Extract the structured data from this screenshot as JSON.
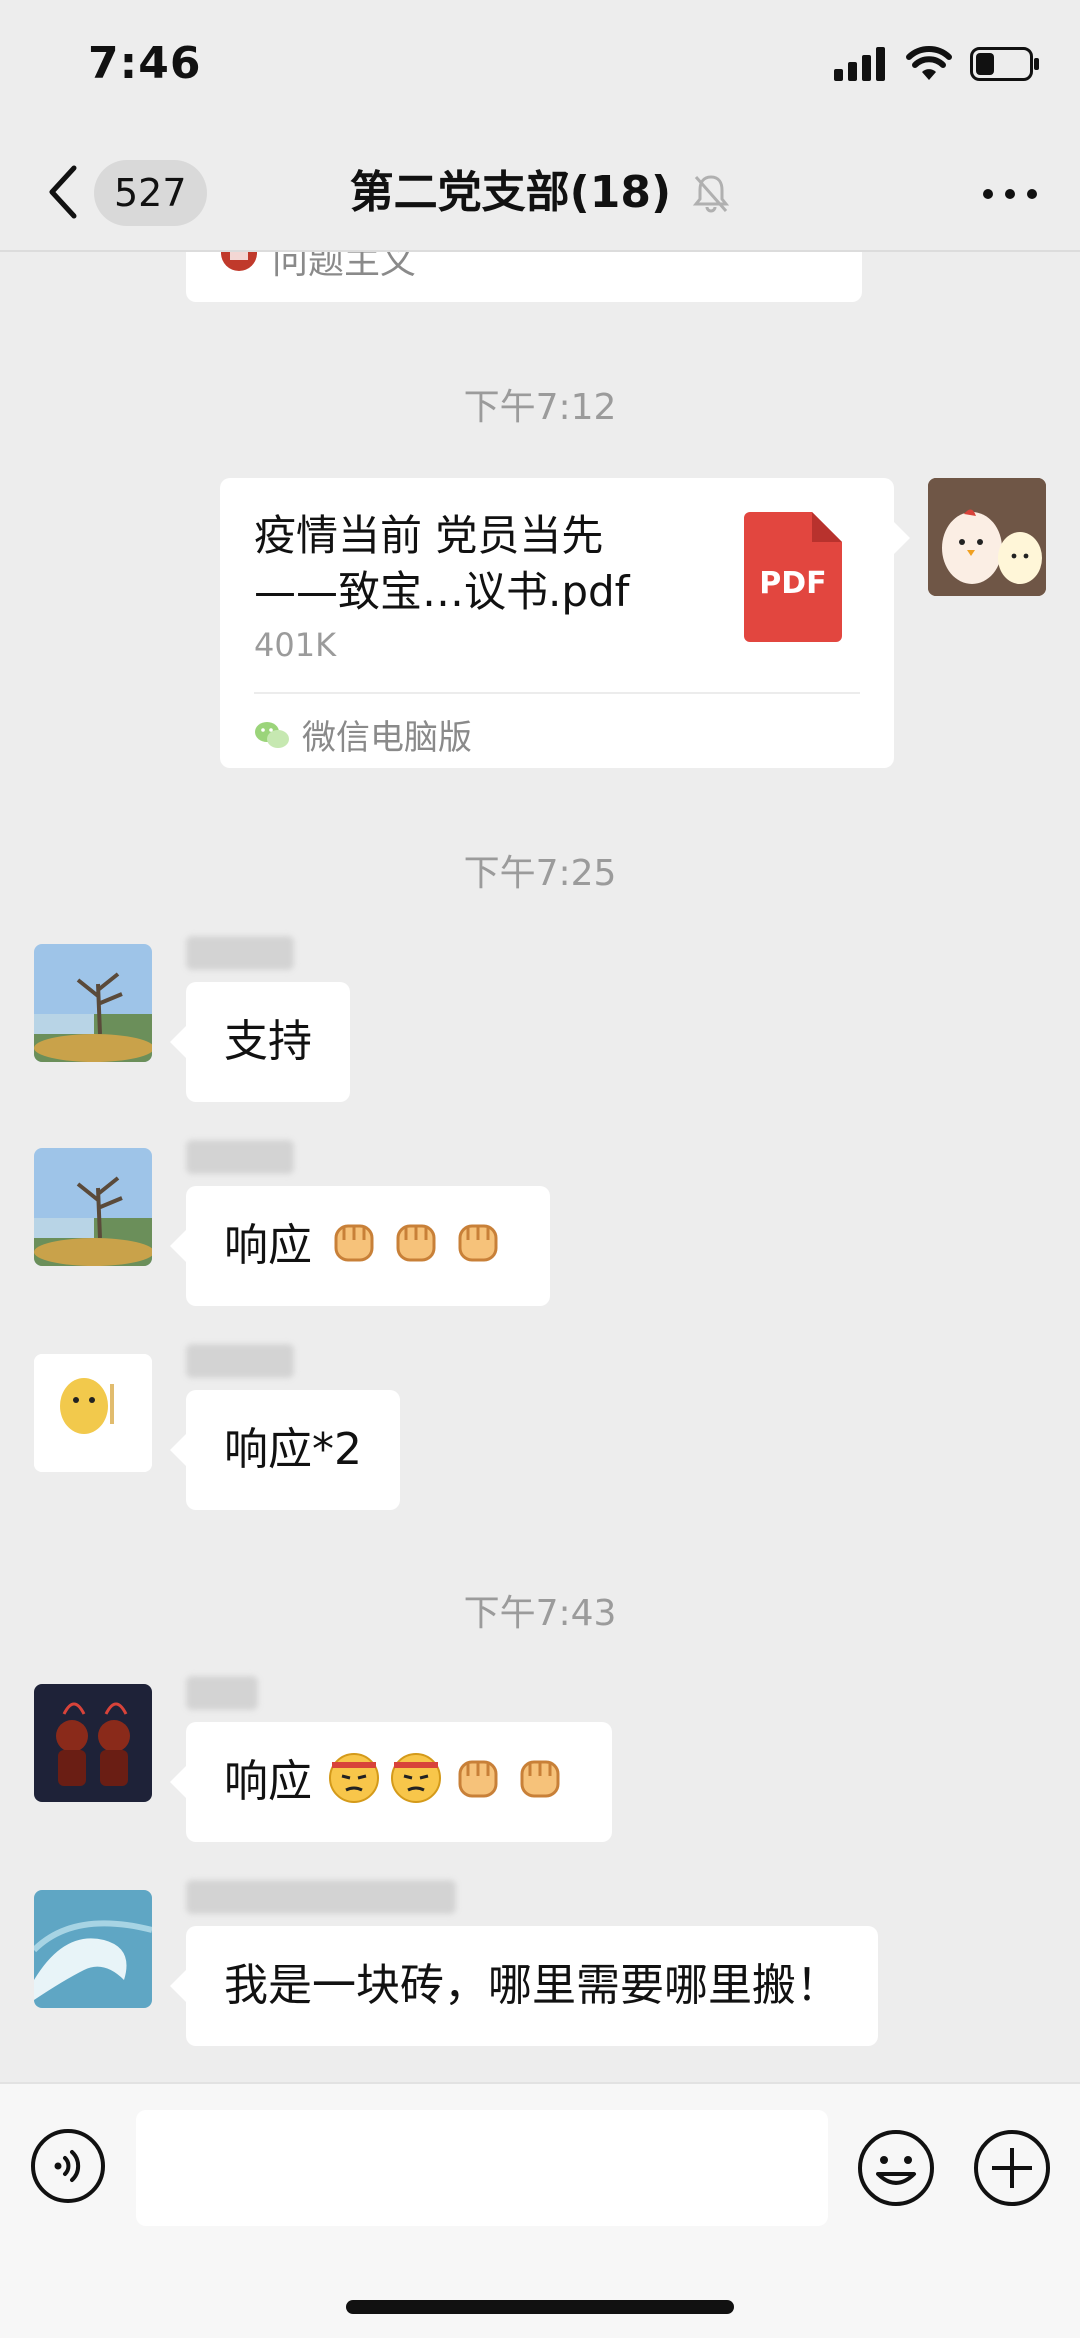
{
  "status_bar": {
    "time": "7:46"
  },
  "nav": {
    "back_count": "527",
    "title": "第二党支部(18)"
  },
  "top_card": {
    "text": "问题主义"
  },
  "messages": [
    {
      "type": "timestamp",
      "text": "下午7:12"
    },
    {
      "type": "file",
      "direction": "outgoing",
      "title": "疫情当前 党员当先——致宝…议书.pdf",
      "title_line1": "疫情当前 党员当先",
      "title_line2": "——致宝…议书.pdf",
      "size": "401K",
      "file_icon_label": "PDF",
      "source": "微信电脑版"
    },
    {
      "type": "timestamp",
      "text": "下午7:25"
    },
    {
      "type": "text",
      "direction": "incoming",
      "text": "支持"
    },
    {
      "type": "text",
      "direction": "incoming",
      "text": "响应",
      "emojis": [
        "fist-icon",
        "fist-icon",
        "fist-icon"
      ]
    },
    {
      "type": "text",
      "direction": "incoming",
      "text": "响应*2"
    },
    {
      "type": "timestamp",
      "text": "下午7:43"
    },
    {
      "type": "text",
      "direction": "incoming",
      "text": "响应",
      "emojis": [
        "determined-face-icon",
        "determined-face-icon",
        "fist-icon",
        "fist-icon"
      ]
    },
    {
      "type": "text",
      "direction": "incoming",
      "text": "我是一块砖，哪里需要哪里搬！"
    }
  ],
  "input_bar": {
    "voice_icon": "voice-icon",
    "emoji_icon": "emoji-icon",
    "plus_icon": "plus-icon"
  },
  "colors": {
    "background": "#ededed",
    "bubble_incoming": "#ffffff",
    "timestamp": "#9b9b9b",
    "pdf_red": "#e2463f"
  }
}
